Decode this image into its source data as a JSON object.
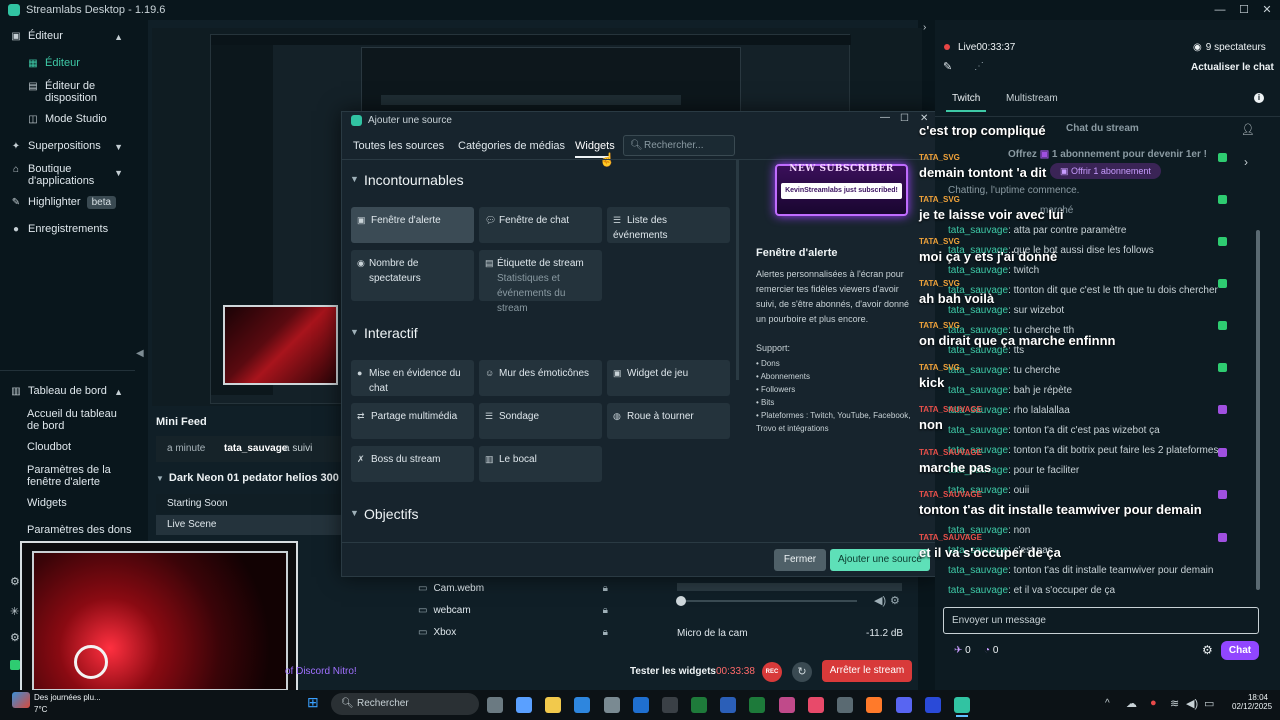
{
  "app": {
    "title": "Streamlabs Desktop - 1.19.6"
  },
  "sidebar": {
    "editor": "Éditeur",
    "editor_sub": [
      "Éditeur",
      "Éditeur de disposition",
      "Mode Studio"
    ],
    "overlays": "Superpositions",
    "store": "Boutique d'applications",
    "highlighter": "Highlighter",
    "beta": "beta",
    "recordings": "Enregistrements",
    "dashboard": "Tableau de bord",
    "dashboard_sub": [
      "Accueil du tableau de bord",
      "Cloudbot",
      "Paramètres de la fenêtre d'alerte",
      "Widgets",
      "Paramètres des dons"
    ]
  },
  "minifeed": {
    "title": "Mini Feed",
    "time": "a minute",
    "user": "tata_sauvage",
    "action": "a suivi"
  },
  "scenes": {
    "collection": "Dark Neon 01 pedator helios 300",
    "items": [
      "Starting Soon",
      "Live Scene"
    ]
  },
  "sources": [
    "Cam.webm",
    "webcam",
    "Xbox"
  ],
  "mixer": {
    "label": "Micro de la cam",
    "db": "-11.2 dB"
  },
  "footer": {
    "discord": "of Discord Nitro!",
    "test_widgets": "Tester les widgets",
    "timer": "00:33:38",
    "rec": "REC",
    "stop": "Arrêter le stream"
  },
  "modal": {
    "title": "Ajouter une source",
    "tabs": [
      "Toutes les sources",
      "Catégories de médias",
      "Widgets"
    ],
    "search_placeholder": "Rechercher...",
    "sections": [
      "Incontournables",
      "Interactif",
      "Objectifs"
    ],
    "cards": {
      "alert": "Fenêtre d'alerte",
      "chat": "Fenêtre de chat",
      "events": "Liste des événements",
      "viewers": "Nombre de spectateurs",
      "label": "Étiquette de stream",
      "label_sub": "Statistiques et événements du stream",
      "highlight": "Mise en évidence du chat",
      "emote": "Mur des émoticônes",
      "game": "Widget de jeu",
      "media": "Partage multimédia",
      "poll": "Sondage",
      "wheel": "Roue à tourner",
      "boss": "Boss du stream",
      "jar": "Le bocal"
    },
    "preview": {
      "badge_top": "NEW SUBSCRIBER",
      "badge_text": "KevinStreamlabs just subscribed!",
      "title": "Fenêtre d'alerte",
      "desc": "Alertes personnalisées à l'écran pour remercier tes fidèles viewers d'avoir suivi, de s'être abonnés, d'avoir donné un pourboire et plus encore.",
      "support_label": "Support:",
      "support": [
        "Dons",
        "Abonnements",
        "Followers",
        "Bits",
        "Plateformes : Twitch, YouTube, Facebook, Trovo et intégrations"
      ]
    },
    "btn_close": "Fermer",
    "btn_add": "Ajouter une source"
  },
  "chat": {
    "live": "Live",
    "live_time": "00:33:37",
    "viewers": "9 spectateurs",
    "refresh": "Actualiser le chat",
    "tabs": [
      "Twitch",
      "Multistream"
    ],
    "chat_title": "Chat du stream",
    "offer": "Offrez",
    "offer_rest": "1 abonnement pour devenir 1er !",
    "offer_btn": "Offrir 1 abonnement",
    "chatting": "Chatting, l'uptime commence.",
    "marche": "marché",
    "placeholder": "Envoyer un message",
    "points1": "0",
    "points2": "0",
    "chat_btn": "Chat",
    "overlay": [
      {
        "user": "",
        "text": "c'est trop compliqué"
      },
      {
        "user": "TATA_SVG",
        "text": "demain tontont 'a dit"
      },
      {
        "user": "TATA_SVG",
        "text": "je te laisse voir avec lui"
      },
      {
        "user": "TATA_SVG",
        "text": "moi ça y ets j'ai donné"
      },
      {
        "user": "TATA_SVG",
        "text": "ah bah voilà"
      },
      {
        "user": "TATA_SVG",
        "text": "on dirait que ça marche enfinnn"
      },
      {
        "user": "TATA_SVG",
        "text": "kick"
      },
      {
        "user": "TATA_SAUVAGE",
        "text": "non"
      },
      {
        "user": "TATA_SAUVAGE",
        "text": "marche pas"
      },
      {
        "user": "TATA_SAUVAGE",
        "text": "tonton t'as dit installe teamwiver pour demain"
      },
      {
        "user": "TATA_SAUVAGE",
        "text": "et il va s'occuper de ça"
      }
    ],
    "messages": [
      {
        "user": "tata_sauvage",
        "text": "atta par contre paramètre"
      },
      {
        "user": "tata_sauvage",
        "text": "que le bot aussi dise les follows"
      },
      {
        "user": "tata_sauvage",
        "text": "twitch"
      },
      {
        "user": "tata_sauvage",
        "text": "ttonton dit que c'est le tth que tu dois chercher"
      },
      {
        "user": "tata_sauvage",
        "text": "sur wizebot"
      },
      {
        "user": "tata_sauvage",
        "text": "tu cherche tth"
      },
      {
        "user": "tata_sauvage",
        "text": "tts"
      },
      {
        "user": "tata_sauvage",
        "text": "tu cherche"
      },
      {
        "user": "tata_sauvage",
        "text": "bah je répète"
      },
      {
        "user": "tata_sauvage",
        "text": "rho lalalallaa"
      },
      {
        "user": "tata_sauvage",
        "text": "tonton t'a dit c'est pas wizebot ça"
      },
      {
        "user": "tata_sauvage",
        "text": "tonton t'a dit botrix peut faire les 2 plateformes"
      },
      {
        "user": "tata_sauvage",
        "text": "pour te faciliter"
      },
      {
        "user": "tata_sauvage",
        "text": "ouii"
      },
      {
        "user": "tata_sauvage",
        "text": "non"
      },
      {
        "user": "tata_sauvage",
        "text": "c'est pas"
      },
      {
        "user": "tata_sauvage",
        "text": "tonton t'as dit installe teamwiver pour demain"
      },
      {
        "user": "tata_sauvage",
        "text": "et il va s'occuper de ça"
      }
    ]
  },
  "taskbar": {
    "weather": "Des journées plu...",
    "temp": "7°C",
    "search": "Rechercher",
    "time": "18:04",
    "date": "02/12/2025"
  }
}
